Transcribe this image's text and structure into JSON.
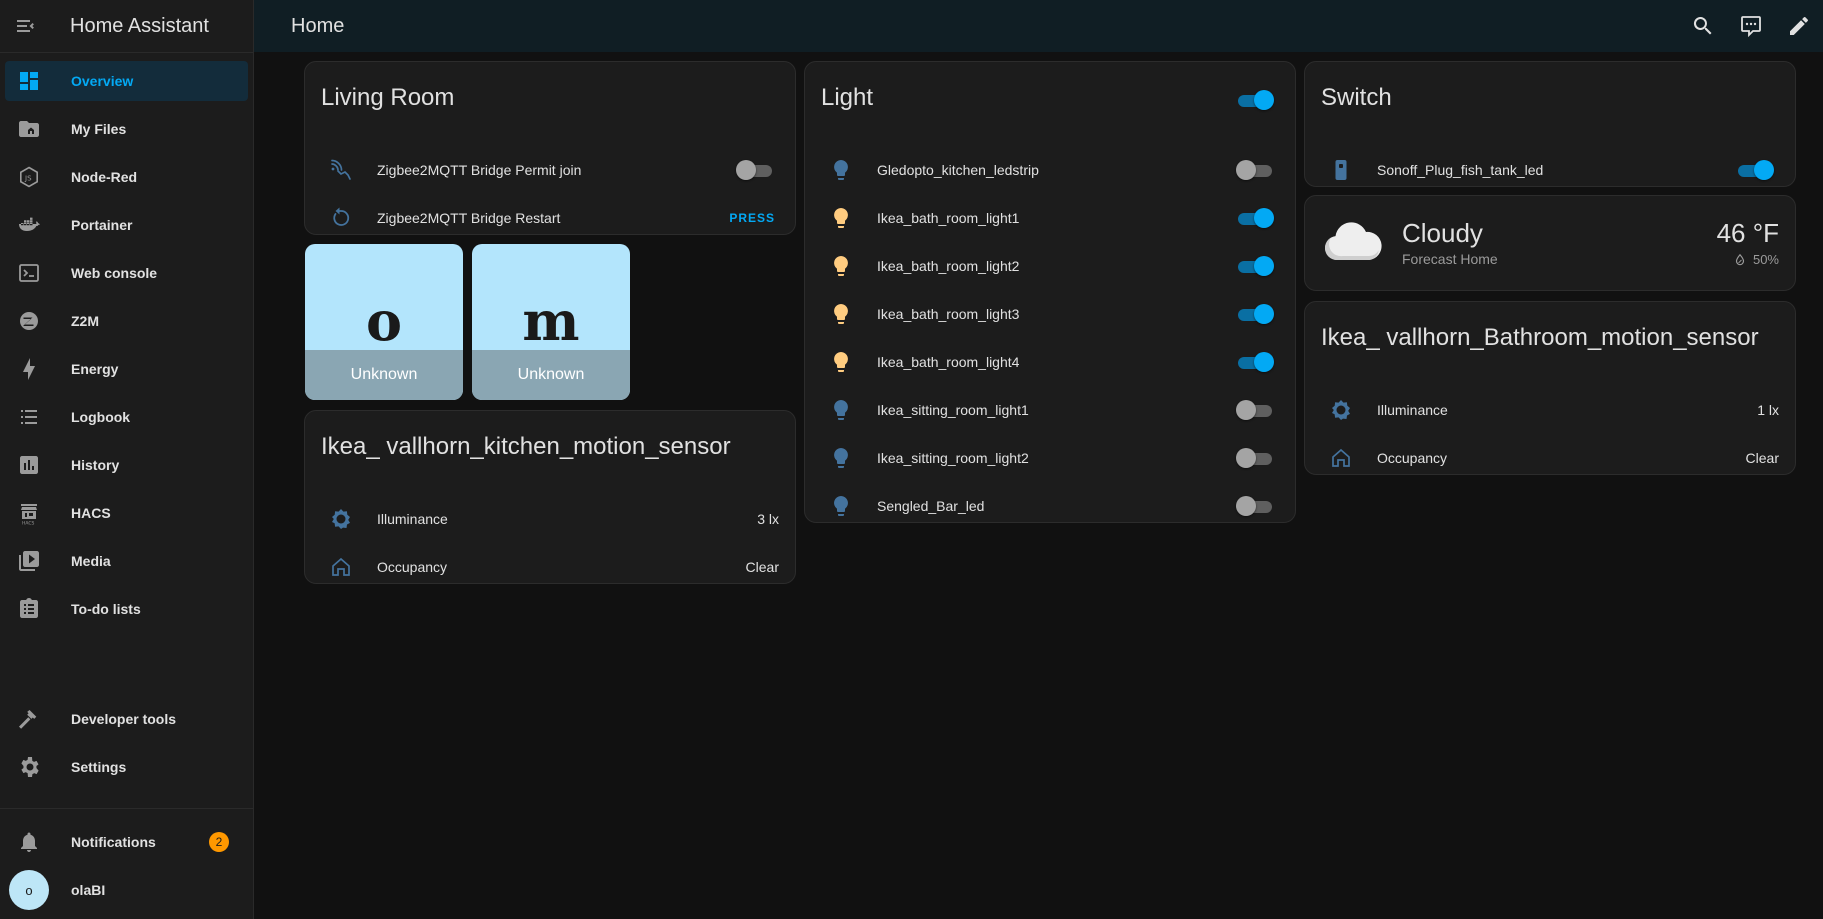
{
  "app": {
    "title": "Home Assistant"
  },
  "sidebar": {
    "items": [
      {
        "label": "Overview",
        "icon": "dashboard-icon",
        "active": true
      },
      {
        "label": "My Files",
        "icon": "folder-home-icon"
      },
      {
        "label": "Node-Red",
        "icon": "nodejs-icon"
      },
      {
        "label": "Portainer",
        "icon": "docker-icon"
      },
      {
        "label": "Web console",
        "icon": "console-icon"
      },
      {
        "label": "Z2M",
        "icon": "zigbee-icon"
      },
      {
        "label": "Energy",
        "icon": "lightning-bolt-icon"
      },
      {
        "label": "Logbook",
        "icon": "format-list-bulleted-icon"
      },
      {
        "label": "History",
        "icon": "chart-box-icon"
      },
      {
        "label": "HACS",
        "icon": "hacs-icon"
      },
      {
        "label": "Media",
        "icon": "play-box-multiple-icon"
      },
      {
        "label": "To-do lists",
        "icon": "clipboard-list-icon"
      }
    ],
    "bottom": [
      {
        "label": "Developer tools",
        "icon": "hammer-icon"
      },
      {
        "label": "Settings",
        "icon": "cog-icon"
      }
    ],
    "notifications": {
      "label": "Notifications",
      "count": "2"
    },
    "user": {
      "name": "olaBI",
      "initial": "o"
    }
  },
  "topbar": {
    "title": "Home"
  },
  "living_room": {
    "title": "Living Room",
    "rows": [
      {
        "name": "Zigbee2MQTT Bridge Permit join",
        "state": "off"
      },
      {
        "name": "Zigbee2MQTT Bridge Restart",
        "action": "PRESS"
      }
    ]
  },
  "tiles": [
    {
      "letter": "o",
      "label": "Unknown"
    },
    {
      "letter": "m",
      "label": "Unknown"
    }
  ],
  "kitchen_sensor": {
    "title": "Ikea_ vallhorn_kitchen_motion_sensor",
    "rows": [
      {
        "name": "Illuminance",
        "value": "3 lx"
      },
      {
        "name": "Occupancy",
        "value": "Clear"
      }
    ]
  },
  "light": {
    "title": "Light",
    "header_toggle": "on",
    "rows": [
      {
        "name": "Gledopto_kitchen_ledstrip",
        "state": "off"
      },
      {
        "name": "Ikea_bath_room_light1",
        "state": "on"
      },
      {
        "name": "Ikea_bath_room_light2",
        "state": "on"
      },
      {
        "name": "Ikea_bath_room_light3",
        "state": "on"
      },
      {
        "name": "Ikea_bath_room_light4",
        "state": "on"
      },
      {
        "name": "Ikea_sitting_room_light1",
        "state": "off"
      },
      {
        "name": "Ikea_sitting_room_light2",
        "state": "off"
      },
      {
        "name": "Sengled_Bar_led",
        "state": "off"
      }
    ]
  },
  "switch": {
    "title": "Switch",
    "rows": [
      {
        "name": "Sonoff_Plug_fish_tank_led",
        "state": "on"
      }
    ]
  },
  "weather": {
    "condition": "Cloudy",
    "source": "Forecast Home",
    "temperature": "46 °F",
    "humidity": "50%"
  },
  "bathroom_sensor": {
    "title": "Ikea_ vallhorn_Bathroom_motion_sensor",
    "rows": [
      {
        "name": "Illuminance",
        "value": "1 lx"
      },
      {
        "name": "Occupancy",
        "value": "Clear"
      }
    ]
  },
  "colors": {
    "accent": "#03a9f4",
    "light_on": "#ffcc80",
    "light_off": "#44739e",
    "icon_gray": "#9b9b9b"
  }
}
